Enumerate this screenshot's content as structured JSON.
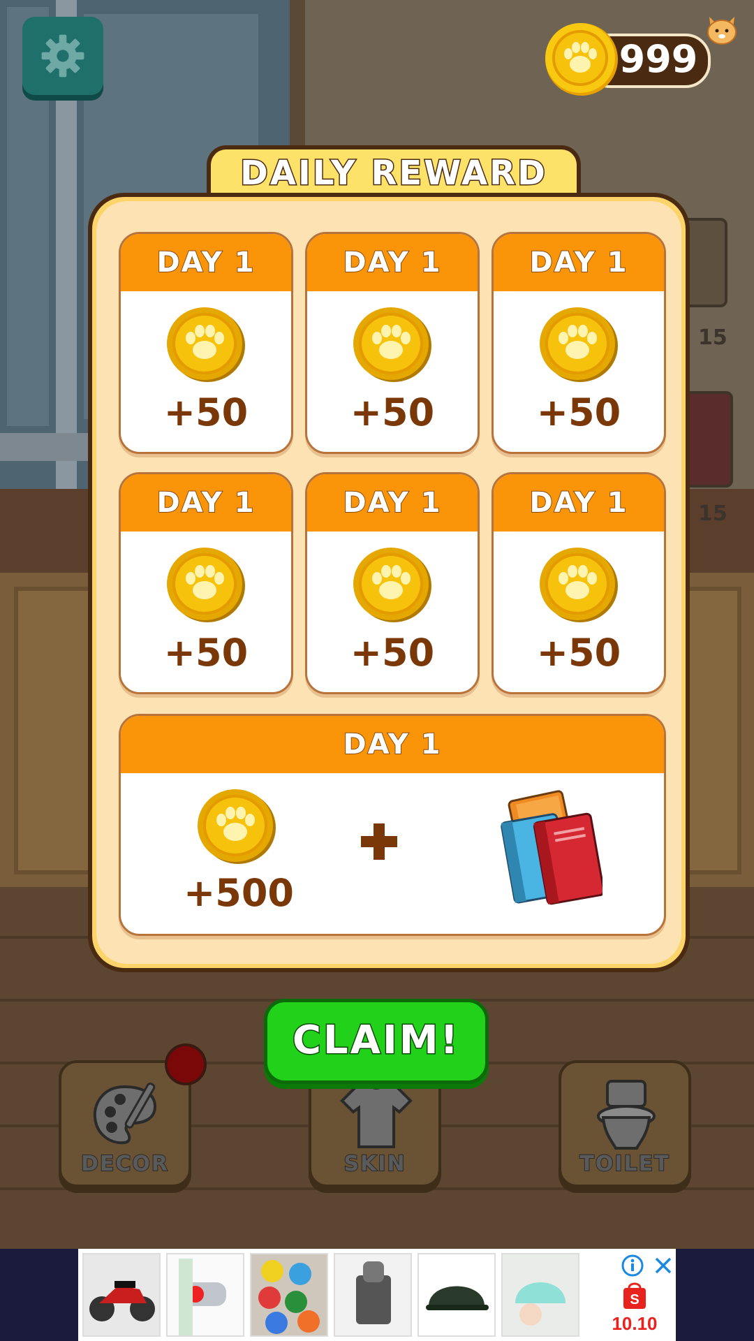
{
  "header": {
    "coin_total": "999"
  },
  "modal": {
    "title": "DAILY REWARD",
    "cards": [
      {
        "day_label": "DAY 1",
        "amount": "+50"
      },
      {
        "day_label": "DAY 1",
        "amount": "+50"
      },
      {
        "day_label": "DAY 1",
        "amount": "+50"
      },
      {
        "day_label": "DAY 1",
        "amount": "+50"
      },
      {
        "day_label": "DAY 1",
        "amount": "+50"
      },
      {
        "day_label": "DAY 1",
        "amount": "+50"
      }
    ],
    "big_card": {
      "day_label": "DAY 1",
      "amount": "+500",
      "bonus_icon": "books-icon"
    },
    "claim_label": "CLAIM!"
  },
  "dock": {
    "decor_label": "DECOR",
    "skin_label": "SKIN",
    "toilet_label": "TOILET"
  },
  "background": {
    "side_price_1": "15",
    "side_price_2": "15"
  },
  "ad": {
    "badge_text": "10.10"
  },
  "colors": {
    "card_header": "#fa9509",
    "amount_text": "#7a3808",
    "claim_green": "#22d21a",
    "modal_border": "#4a2a10",
    "modal_fill": "#fde2b4",
    "coin_gold": "#f6c20b"
  }
}
